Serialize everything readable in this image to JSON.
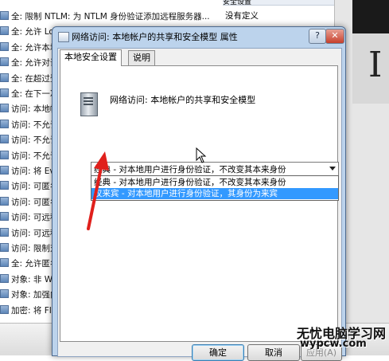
{
  "background": {
    "column_header": "安全设置",
    "rows": [
      {
        "text": "全: 限制 NTLM: 为 NTLM 身份验证添加远程服务器...",
        "setting": "没有定义"
      },
      {
        "text": "全: 允许 Lo",
        "setting": ""
      },
      {
        "text": "全: 允许本地",
        "setting": ""
      },
      {
        "text": "全: 允许对话",
        "setting": ""
      },
      {
        "text": "全: 在超过登",
        "setting": ""
      },
      {
        "text": "全: 在下一次",
        "setting": ""
      },
      {
        "text": "访问: 本地帐户",
        "setting": ""
      },
      {
        "text": "访问: 不允许 S",
        "setting": ""
      },
      {
        "text": "访问: 不允许 S",
        "setting": ""
      },
      {
        "text": "访问: 不允许存",
        "setting": ""
      },
      {
        "text": "访问: 将 Every",
        "setting": ""
      },
      {
        "text": "访问: 可匿名访",
        "setting": ""
      },
      {
        "text": "访问: 可匿名访",
        "setting": ""
      },
      {
        "text": "访问: 可远程访",
        "setting": ""
      },
      {
        "text": "访问: 可远程访",
        "setting": ""
      },
      {
        "text": "访问: 限制对命",
        "setting": ""
      },
      {
        "text": "全: 允许匿名",
        "setting": ""
      },
      {
        "text": "对象: 非 Windo",
        "setting": ""
      },
      {
        "text": "对象: 加强内部",
        "setting": ""
      },
      {
        "text": "加密: 将 FIPS",
        "setting": ""
      }
    ],
    "buttons": {
      "ok": "确定",
      "cancel": "取消",
      "apply": "应用(A)"
    }
  },
  "dialog": {
    "title": "网络访问: 本地帐户的共享和安全模型 属性",
    "help_label": "?",
    "close_label": "✕",
    "tabs": [
      {
        "label": "本地安全设置",
        "active": true
      },
      {
        "label": "说明",
        "active": false
      }
    ],
    "policy_name": "网络访问: 本地帐户的共享和安全模型",
    "select": {
      "value": "经典 - 对本地用户进行身份验证，不改变其本来身份",
      "options": [
        {
          "label": "经典 - 对本地用户进行身份验证，不改变其本来身份",
          "highlighted": false
        },
        {
          "label": "仅来宾 - 对本地用户进行身份验证，其身份为来宾",
          "highlighted": true
        }
      ]
    },
    "buttons": {
      "ok": "确定",
      "cancel": "取消",
      "apply": "应用(A)"
    }
  },
  "watermark": {
    "name": "无忧电脑学习网",
    "url": "wypcw.com"
  },
  "colors": {
    "highlight": "#3399ff",
    "annotation_arrow": "#e0201c",
    "titlebar": "#bcd3ec"
  },
  "icons": {
    "window": "policy-window-icon",
    "policy": "server-policy-icon",
    "dropdown": "chevron-down-icon",
    "cursor": "mouse-pointer-icon"
  }
}
